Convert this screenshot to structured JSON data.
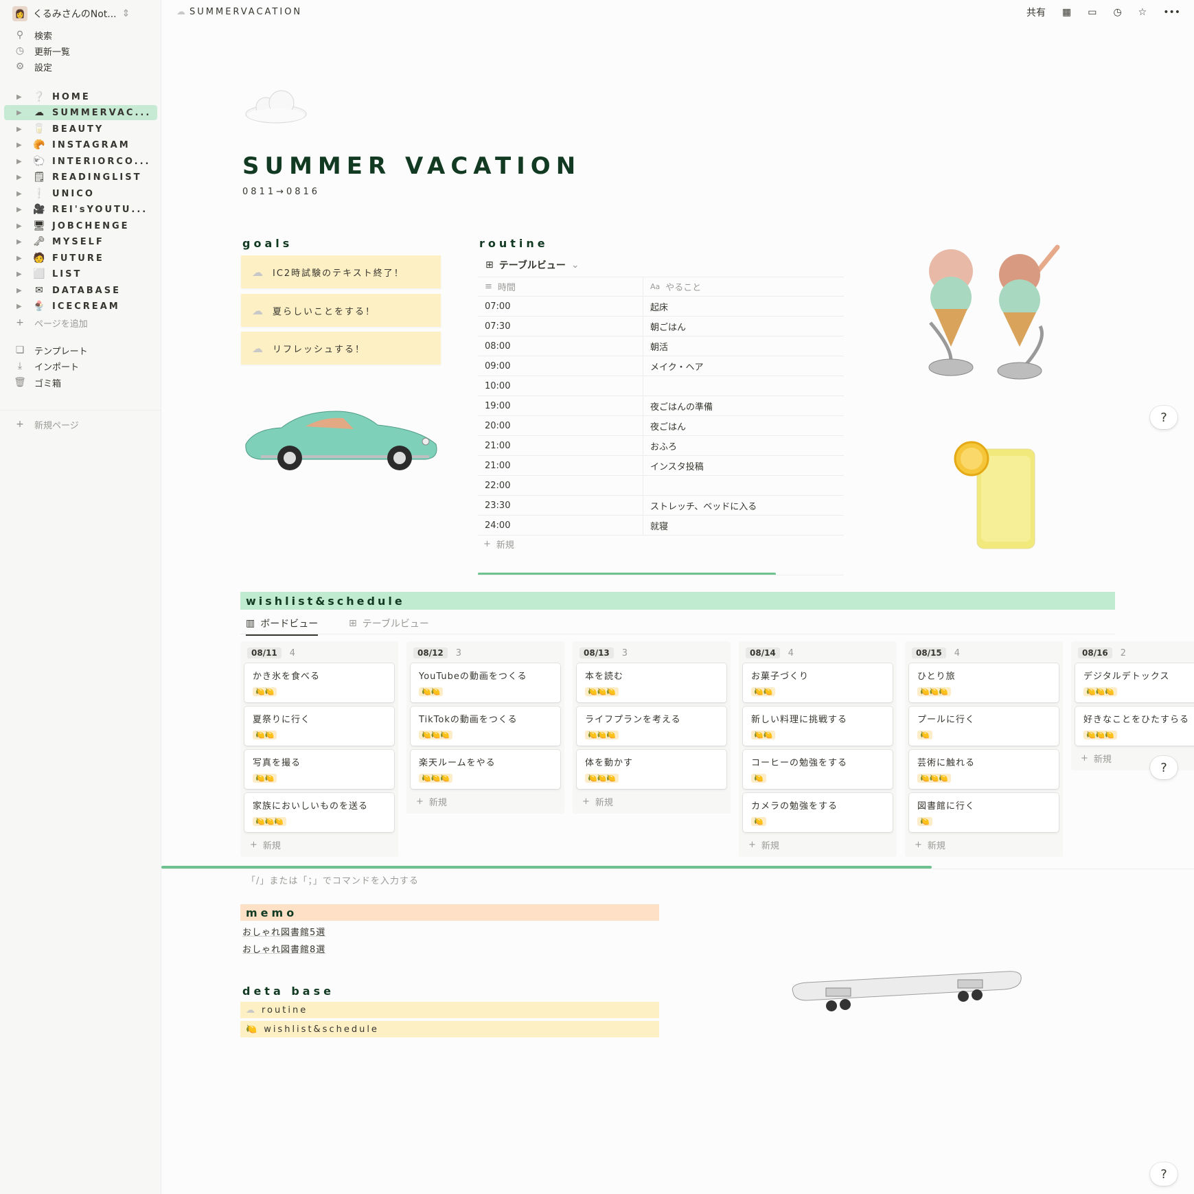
{
  "sidebar": {
    "workspace": "くるみさんのNot...",
    "top_items": [
      {
        "icon": "search-icon",
        "label": "検索"
      },
      {
        "icon": "clock-icon",
        "label": "更新一覧"
      },
      {
        "icon": "gear-icon",
        "label": "設定"
      }
    ],
    "pages": [
      {
        "emoji": "❔",
        "label": "HOME"
      },
      {
        "emoji": "☁",
        "label": "SUMMERVAC...",
        "active": true
      },
      {
        "emoji": "🥛",
        "label": "BEAUTY"
      },
      {
        "emoji": "🥐",
        "label": "INSTAGRAM"
      },
      {
        "emoji": "🐑",
        "label": "INTERIORCO..."
      },
      {
        "emoji": "🗒",
        "label": "READINGLIST"
      },
      {
        "emoji": "❕",
        "label": "UNICO"
      },
      {
        "emoji": "🎥",
        "label": "REI'sYOUTU..."
      },
      {
        "emoji": "🖥",
        "label": "JOBCHENGE"
      },
      {
        "emoji": "🗝",
        "label": "MYSELF"
      },
      {
        "emoji": "🧑",
        "label": "FUTURE"
      },
      {
        "emoji": "⬜",
        "label": "LIST"
      },
      {
        "emoji": "✉",
        "label": "DATABASE"
      },
      {
        "emoji": "🍨",
        "label": "ICECREAM"
      }
    ],
    "add_page": "ページを追加",
    "bottom_items": [
      {
        "icon": "template-icon",
        "label": "テンプレート"
      },
      {
        "icon": "import-icon",
        "label": "インポート"
      },
      {
        "icon": "trash-icon",
        "label": "ゴミ箱"
      }
    ],
    "new_page": "新規ページ"
  },
  "topbar": {
    "breadcrumb": "SUMMERVACATION",
    "share": "共有"
  },
  "page": {
    "title": "SUMMER VACATION",
    "subtitle": "0811→0816"
  },
  "goals": {
    "heading": "goals",
    "items": [
      "IC2時試験のテキスト終了！",
      "夏らしいことをする！",
      "リフレッシュする！"
    ]
  },
  "routine": {
    "heading": "routine",
    "view_label": "テーブルビュー",
    "col_time": "時間",
    "col_task": "やること",
    "rows": [
      {
        "time": "07:00",
        "task": "起床"
      },
      {
        "time": "07:30",
        "task": "朝ごはん"
      },
      {
        "time": "08:00",
        "task": "朝活"
      },
      {
        "time": "09:00",
        "task": "メイク・ヘア"
      },
      {
        "time": "10:00",
        "task": ""
      },
      {
        "time": "19:00",
        "task": "夜ごはんの準備"
      },
      {
        "time": "20:00",
        "task": "夜ごはん"
      },
      {
        "time": "21:00",
        "task": "おふろ"
      },
      {
        "time": "21:00",
        "task": "インスタ投稿"
      },
      {
        "time": "22:00",
        "task": ""
      },
      {
        "time": "23:30",
        "task": "ストレッチ、ベッドに入る"
      },
      {
        "time": "24:00",
        "task": "就寝"
      }
    ],
    "new_label": "新規"
  },
  "wishlist": {
    "heading": "wishlist&schedule",
    "tab_board": "ボードビュー",
    "tab_table": "テーブルビュー",
    "new_label": "新規",
    "columns": [
      {
        "date": "08/11",
        "count": "4",
        "cards": [
          {
            "title": "かき氷を食べる",
            "lemons": "🍋🍋"
          },
          {
            "title": "夏祭りに行く",
            "lemons": "🍋🍋"
          },
          {
            "title": "写真を撮る",
            "lemons": "🍋🍋"
          },
          {
            "title": "家族においしいものを送る",
            "lemons": "🍋🍋🍋"
          }
        ]
      },
      {
        "date": "08/12",
        "count": "3",
        "cards": [
          {
            "title": "YouTubeの動画をつくる",
            "lemons": "🍋🍋"
          },
          {
            "title": "TikTokの動画をつくる",
            "lemons": "🍋🍋🍋"
          },
          {
            "title": "楽天ルームをやる",
            "lemons": "🍋🍋🍋"
          }
        ]
      },
      {
        "date": "08/13",
        "count": "3",
        "cards": [
          {
            "title": "本を読む",
            "lemons": "🍋🍋🍋"
          },
          {
            "title": "ライフプランを考える",
            "lemons": "🍋🍋🍋"
          },
          {
            "title": "体を動かす",
            "lemons": "🍋🍋🍋"
          }
        ]
      },
      {
        "date": "08/14",
        "count": "4",
        "cards": [
          {
            "title": "お菓子づくり",
            "lemons": "🍋🍋"
          },
          {
            "title": "新しい料理に挑戦する",
            "lemons": "🍋🍋"
          },
          {
            "title": "コーヒーの勉強をする",
            "lemons": "🍋"
          },
          {
            "title": "カメラの勉強をする",
            "lemons": "🍋"
          }
        ]
      },
      {
        "date": "08/15",
        "count": "4",
        "cards": [
          {
            "title": "ひとり旅",
            "lemons": "🍋🍋🍋"
          },
          {
            "title": "プールに行く",
            "lemons": "🍋"
          },
          {
            "title": "芸術に触れる",
            "lemons": "🍋🍋🍋"
          },
          {
            "title": "図書館に行く",
            "lemons": "🍋"
          }
        ]
      },
      {
        "date": "08/16",
        "count": "2",
        "cards": [
          {
            "title": "デジタルデトックス",
            "lemons": "🍋🍋🍋"
          },
          {
            "title": "好きなことをひたすらる",
            "lemons": "🍋🍋🍋"
          }
        ]
      }
    ]
  },
  "command_hint": "「/」または「；」でコマンドを入力する",
  "memo": {
    "heading": "memo",
    "links": [
      "おしゃれ図書館5選",
      "おしゃれ図書館8選"
    ]
  },
  "database": {
    "heading": "deta base",
    "items": [
      {
        "emoji": "☁",
        "label": "routine"
      },
      {
        "emoji": "🍋",
        "label": "wishlist&schedule"
      }
    ]
  },
  "help_label": "?"
}
